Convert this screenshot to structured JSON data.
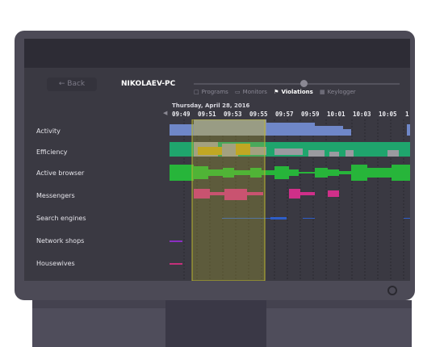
{
  "header": {
    "back_label": "Back",
    "back_icon": "arrow-left-icon",
    "computer_name": "NIKOLAEV-PC"
  },
  "tabs": [
    {
      "label": "Programs",
      "icon": "window-icon",
      "active": false
    },
    {
      "label": "Monitors",
      "icon": "monitor-icon",
      "active": false
    },
    {
      "label": "Violations",
      "icon": "flag-icon",
      "active": true
    },
    {
      "label": "Keylogger",
      "icon": "keyboard-icon",
      "active": false
    }
  ],
  "timeline": {
    "date": "Thursday, April 28, 2016",
    "times": [
      "09:49",
      "09:51",
      "09:53",
      "09:55",
      "09:57",
      "09:59",
      "10:01",
      "10:03",
      "10:05",
      "1"
    ]
  },
  "rows": [
    {
      "label": "Activity"
    },
    {
      "label": "Efficiency"
    },
    {
      "label": "Active browser"
    },
    {
      "label": "Messengers"
    },
    {
      "label": "Search engines"
    },
    {
      "label": "Network shops"
    },
    {
      "label": "Housewives"
    }
  ],
  "colors": {
    "activity": "#6f87c8",
    "activity_muted": "#8d93a6",
    "efficiency": "#1fa56d",
    "efficiency_gray": "#9a9aa0",
    "efficiency_gold": "#c4a21f",
    "browser": "#27b53a",
    "messengers": "#cf2f89",
    "search": "#2e5ec9",
    "shops": "#8b2fc2",
    "housewives": "#c4307a",
    "selection": "#b9b430"
  }
}
